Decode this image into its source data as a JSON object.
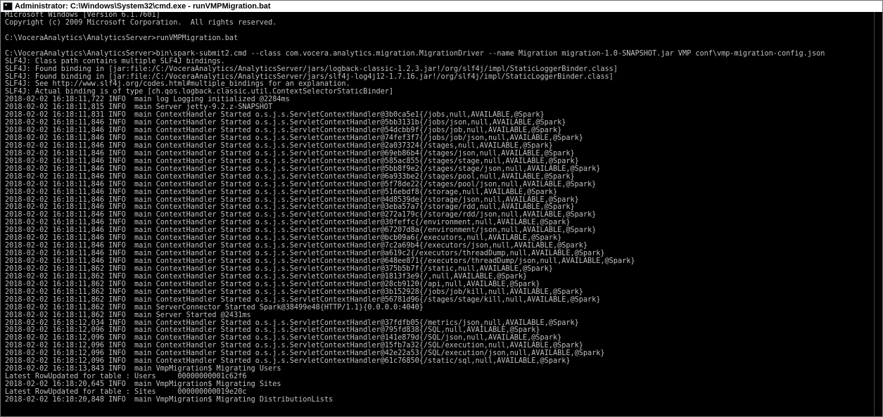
{
  "window": {
    "title": "Administrator: C:\\Windows\\System32\\cmd.exe - runVMPMigration.bat",
    "icon": "cmd-icon",
    "colors": {
      "titlebar_bg": "#ffffff",
      "console_bg": "#000000",
      "console_fg": "#c0c0c0"
    }
  },
  "console": {
    "lines": [
      "Microsoft Windows [Version 6.1.7601]",
      "Copyright (c) 2009 Microsoft Corporation.  All rights reserved.",
      "",
      "C:\\VoceraAnalytics\\AnalyticsServer>runVMPMigration.bat",
      "",
      "C:\\VoceraAnalytics\\AnalyticsServer>bin\\spark-submit2.cmd --class com.vocera.analytics.migration.MigrationDriver --name Migration migration-1.0-SNAPSHOT.jar VMP conf\\vmp-migration-config.json",
      "SLF4J: Class path contains multiple SLF4J bindings.",
      "SLF4J: Found binding in [jar:file:/C:/VoceraAnalytics/AnalyticsServer/jars/logback-classic-1.2.3.jar!/org/slf4j/impl/StaticLoggerBinder.class]",
      "SLF4J: Found binding in [jar:file:/C:/VoceraAnalytics/AnalyticsServer/jars/slf4j-log4j12-1.7.16.jar!/org/slf4j/impl/StaticLoggerBinder.class]",
      "SLF4J: See http://www.slf4j.org/codes.html#multiple_bindings for an explanation.",
      "SLF4J: Actual binding is of type [ch.qos.logback.classic.util.ContextSelectorStaticBinder]",
      "2018-02-02 16:18:11,722 INFO  main log Logging initialized @2284ms",
      "2018-02-02 16:18:11,815 INFO  main Server jetty-9.2.z-SNAPSHOT",
      "2018-02-02 16:18:11,831 INFO  main ContextHandler Started o.s.j.s.ServletContextHandler@3b0ca5e1{/jobs,null,AVAILABLE,@Spark}",
      "2018-02-02 16:18:11,846 INFO  main ContextHandler Started o.s.j.s.ServletContextHandler@5bb3131b{/jobs/json,null,AVAILABLE,@Spark}",
      "2018-02-02 16:18:11,846 INFO  main ContextHandler Started o.s.j.s.ServletContextHandler@54dcbb9f{/jobs/job,null,AVAILABLE,@Spark}",
      "2018-02-02 16:18:11,846 INFO  main ContextHandler Started o.s.j.s.ServletContextHandler@74fef3f7{/jobs/job/json,null,AVAILABLE,@Spark}",
      "2018-02-02 16:18:11,846 INFO  main ContextHandler Started o.s.j.s.ServletContextHandler@2a037324{/stages,null,AVAILABLE,@Spark}",
      "2018-02-02 16:18:11,846 INFO  main ContextHandler Started o.s.j.s.ServletContextHandler@69eb86b4{/stages/json,null,AVAILABLE,@Spark}",
      "2018-02-02 16:18:11,846 INFO  main ContextHandler Started o.s.j.s.ServletContextHandler@585ac855{/stages/stage,null,AVAILABLE,@Spark}",
      "2018-02-02 16:18:11,846 INFO  main ContextHandler Started o.s.j.s.ServletContextHandler@5bb8f9e2{/stages/stage/json,null,AVAILABLE,@Spark}",
      "2018-02-02 16:18:11,846 INFO  main ContextHandler Started o.s.j.s.ServletContextHandler@6a933be2{/stages/pool,null,AVAILABLE,@Spark}",
      "2018-02-02 16:18:11,846 INFO  main ContextHandler Started o.s.j.s.ServletContextHandler@5f78de22{/stages/pool/json,null,AVAILABLE,@Spark}",
      "2018-02-02 16:18:11,846 INFO  main ContextHandler Started o.s.j.s.ServletContextHandler@516ebdf8{/storage,null,AVAILABLE,@Spark}",
      "2018-02-02 16:18:11,846 INFO  main ContextHandler Started o.s.j.s.ServletContextHandler@4d8539de{/storage/json,null,AVAILABLE,@Spark}",
      "2018-02-02 16:18:11,846 INFO  main ContextHandler Started o.s.j.s.ServletContextHandler@3eba57a7{/storage/rdd,null,AVAILABLE,@Spark}",
      "2018-02-02 16:18:11,846 INFO  main ContextHandler Started o.s.j.s.ServletContextHandler@272a179c{/storage/rdd/json,null,AVAILABLE,@Spark}",
      "2018-02-02 16:18:11,846 INFO  main ContextHandler Started o.s.j.s.ServletContextHandler@30feffc{/environment,null,AVAILABLE,@Spark}",
      "2018-02-02 16:18:11,846 INFO  main ContextHandler Started o.s.j.s.ServletContextHandler@67207d8a{/environment/json,null,AVAILABLE,@Spark}",
      "2018-02-02 16:18:11,846 INFO  main ContextHandler Started o.s.j.s.ServletContextHandler@bcb09a6{/executors,null,AVAILABLE,@Spark}",
      "2018-02-02 16:18:11,846 INFO  main ContextHandler Started o.s.j.s.ServletContextHandler@7c2a69b4{/executors/json,null,AVAILABLE,@Spark}",
      "2018-02-02 16:18:11,846 INFO  main ContextHandler Started o.s.j.s.ServletContextHandler@a619c2{/executors/threadDump,null,AVAILABLE,@Spark}",
      "2018-02-02 16:18:11,846 INFO  main ContextHandler Started o.s.j.s.ServletContextHandler@648ee871{/executors/threadDump/json,null,AVAILABLE,@Spark}",
      "2018-02-02 16:18:11,862 INFO  main ContextHandler Started o.s.j.s.ServletContextHandler@375b5b7f{/static,null,AVAILABLE,@Spark}",
      "2018-02-02 16:18:11,862 INFO  main ContextHandler Started o.s.j.s.ServletContextHandler@1813f3e9{/,null,AVAILABLE,@Spark}",
      "2018-02-02 16:18:11,862 INFO  main ContextHandler Started o.s.j.s.ServletContextHandler@28cb9120{/api,null,AVAILABLE,@Spark}",
      "2018-02-02 16:18:11,862 INFO  main ContextHandler Started o.s.j.s.ServletContextHandler@3b152928{/jobs/job/kill,null,AVAILABLE,@Spark}",
      "2018-02-02 16:18:11,862 INFO  main ContextHandler Started o.s.j.s.ServletContextHandler@56781d96{/stages/stage/kill,null,AVAILABLE,@Spark}",
      "2018-02-02 16:18:11,862 INFO  main ServerConnector Started Spark@38499e48{HTTP/1.1}{0.0.0.0:4040}",
      "2018-02-02 16:18:11,862 INFO  main Server Started @2431ms",
      "2018-02-02 16:18:12,034 INFO  main ContextHandler Started o.s.j.s.ServletContextHandler@37fdfb05{/metrics/json,null,AVAILABLE,@Spark}",
      "2018-02-02 16:18:12,096 INFO  main ContextHandler Started o.s.j.s.ServletContextHandler@795fd838{/SQL,null,AVAILABLE,@Spark}",
      "2018-02-02 16:18:12,096 INFO  main ContextHandler Started o.s.j.s.ServletContextHandler@141e879d{/SQL/json,null,AVAILABLE,@Spark}",
      "2018-02-02 16:18:12,096 INFO  main ContextHandler Started o.s.j.s.ServletContextHandler@15fb7a32{/SQL/execution,null,AVAILABLE,@Spark}",
      "2018-02-02 16:18:12,096 INFO  main ContextHandler Started o.s.j.s.ServletContextHandler@42e22a53{/SQL/execution/json,null,AVAILABLE,@Spark}",
      "2018-02-02 16:18:12,096 INFO  main ContextHandler Started o.s.j.s.ServletContextHandler@61c76850{/static/sql,null,AVAILABLE,@Spark}",
      "2018-02-02 16:18:13,843 INFO  main VmpMigration$ Migrating Users",
      "Latest RowUpdated for table : Users     00000000001c62f6",
      "2018-02-02 16:18:20,645 INFO  main VmpMigration$ Migrating Sites",
      "Latest RowUpdated for table : Sites     000000000019e20c",
      "2018-02-02 16:18:20,848 INFO  main VmpMigration$ Migrating DistributionLists"
    ]
  }
}
